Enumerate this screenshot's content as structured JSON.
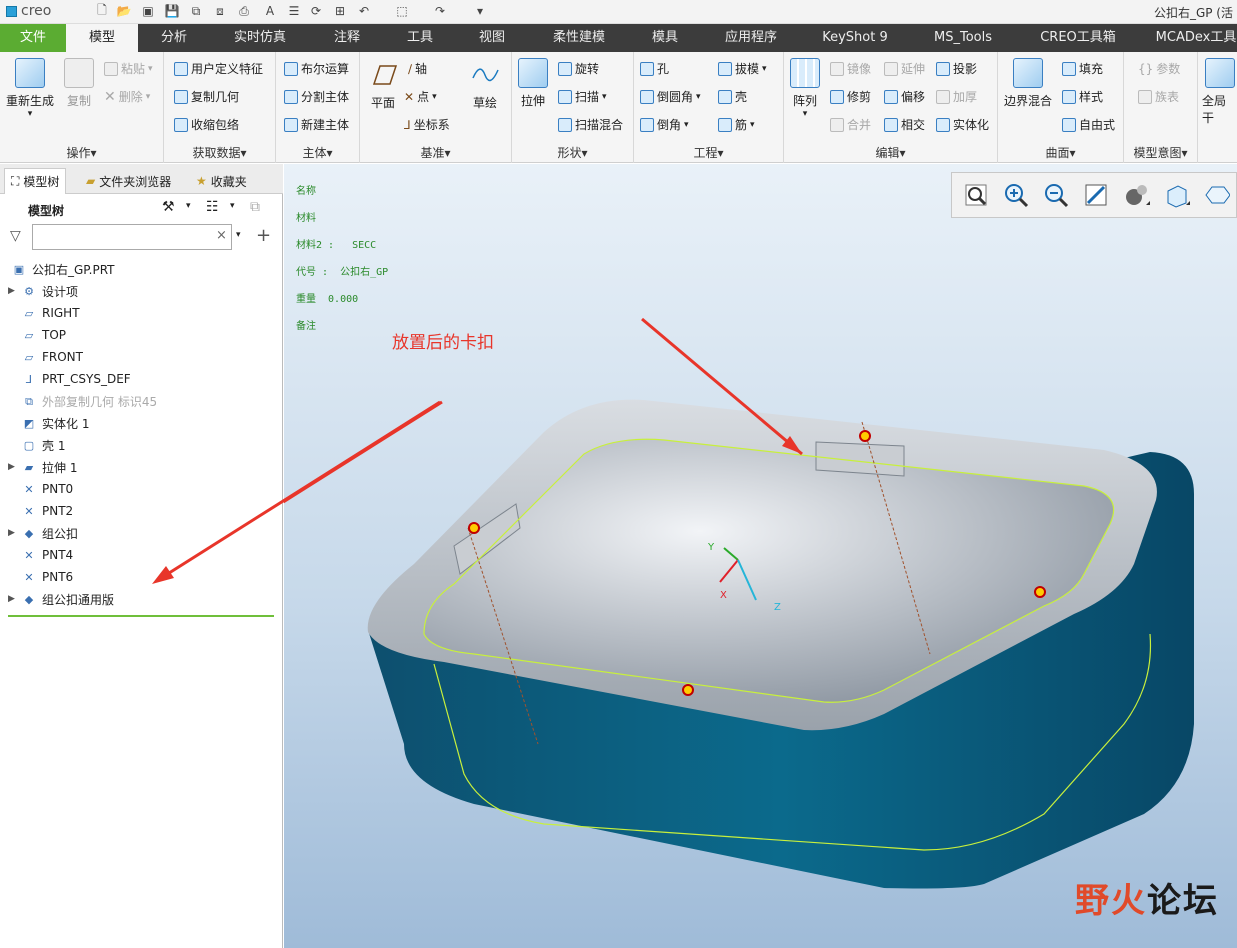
{
  "app": {
    "name": "creo",
    "doc_title": "公扣右_GP (活"
  },
  "tabs": [
    "文件",
    "模型",
    "分析",
    "实时仿真",
    "注释",
    "工具",
    "视图",
    "柔性建模",
    "模具",
    "应用程序",
    "KeyShot 9",
    "MS_Tools",
    "CREO工具箱",
    "MCADex工具"
  ],
  "ribbon": {
    "ops": {
      "label": "操作",
      "regen": "重新生成",
      "copy": "复制",
      "paste": "粘贴",
      "delete": "删除"
    },
    "get": {
      "label": "获取数据",
      "udf": "用户定义特征",
      "copygeom": "复制几何",
      "shrink": "收缩包络"
    },
    "body": {
      "label": "主体",
      "boolean": "布尔运算",
      "split": "分割主体",
      "newbody": "新建主体"
    },
    "datum": {
      "label": "基准",
      "plane": "平面",
      "axis": "轴",
      "point": "点",
      "csys": "坐标系",
      "sketch": "草绘"
    },
    "shape": {
      "label": "形状",
      "extrude": "拉伸",
      "revolve": "旋转",
      "sweep": "扫描",
      "swblend": "扫描混合"
    },
    "eng": {
      "label": "工程",
      "hole": "孔",
      "round": "倒圆角",
      "chamfer": "倒角",
      "draft": "拔模",
      "shell": "壳",
      "rib": "筋"
    },
    "edit": {
      "label": "编辑",
      "pattern": "阵列",
      "mirror": "镜像",
      "trim": "修剪",
      "merge": "合并",
      "extend": "延伸",
      "offset": "偏移",
      "intersect": "相交",
      "project": "投影",
      "thicken": "加厚",
      "solidify": "实体化"
    },
    "surface": {
      "label": "曲面",
      "boundary": "边界混合",
      "fill": "填充",
      "style": "样式",
      "freestyle": "自由式"
    },
    "intent": {
      "label": "模型意图",
      "params": "参数",
      "family": "族表"
    },
    "global": {
      "label": "全局干"
    }
  },
  "panel": {
    "tabs": [
      "模型树",
      "文件夹浏览器",
      "收藏夹"
    ],
    "tree_title": "模型树",
    "search_placeholder": "",
    "items": [
      {
        "label": "公扣右_GP.PRT",
        "icon": "part-icon",
        "expand": false,
        "dim": false
      },
      {
        "label": "设计项",
        "icon": "design-items-icon",
        "expand": true,
        "dim": false
      },
      {
        "label": "RIGHT",
        "icon": "plane-icon",
        "expand": false,
        "dim": false
      },
      {
        "label": "TOP",
        "icon": "plane-icon",
        "expand": false,
        "dim": false
      },
      {
        "label": "FRONT",
        "icon": "plane-icon",
        "expand": false,
        "dim": false
      },
      {
        "label": "PRT_CSYS_DEF",
        "icon": "csys-icon",
        "expand": false,
        "dim": false
      },
      {
        "label": "外部复制几何 标识45",
        "icon": "copy-geom-icon",
        "expand": false,
        "dim": true
      },
      {
        "label": "实体化 1",
        "icon": "solidify-icon",
        "expand": false,
        "dim": false
      },
      {
        "label": "壳 1",
        "icon": "shell-icon",
        "expand": false,
        "dim": false
      },
      {
        "label": "拉伸 1",
        "icon": "extrude-icon",
        "expand": true,
        "dim": false
      },
      {
        "label": "PNT0",
        "icon": "point-icon",
        "expand": false,
        "dim": false
      },
      {
        "label": "PNT2",
        "icon": "point-icon",
        "expand": false,
        "dim": false
      },
      {
        "label": "组公扣",
        "icon": "group-icon",
        "expand": true,
        "dim": false
      },
      {
        "label": "PNT4",
        "icon": "point-icon",
        "expand": false,
        "dim": false
      },
      {
        "label": "PNT6",
        "icon": "point-icon",
        "expand": false,
        "dim": false
      },
      {
        "label": "组公扣通用版",
        "icon": "group-icon",
        "expand": true,
        "dim": false
      }
    ]
  },
  "viewport": {
    "annotations": [
      "名称",
      "材料",
      "材料2 :   SECC",
      "代号 :  公扣右_GP",
      "重量  0.000",
      "备注"
    ],
    "callout": "放置后的卡扣",
    "axes": {
      "x": "X",
      "y": "Y",
      "z": "Z"
    },
    "watermark": {
      "part1": "野火",
      "part2": "论坛"
    }
  },
  "colors": {
    "file_tab": "#5bac32",
    "model_body": "#0b5f80",
    "callout": "#e8352a",
    "edge_highlight": "#c8f03c"
  }
}
